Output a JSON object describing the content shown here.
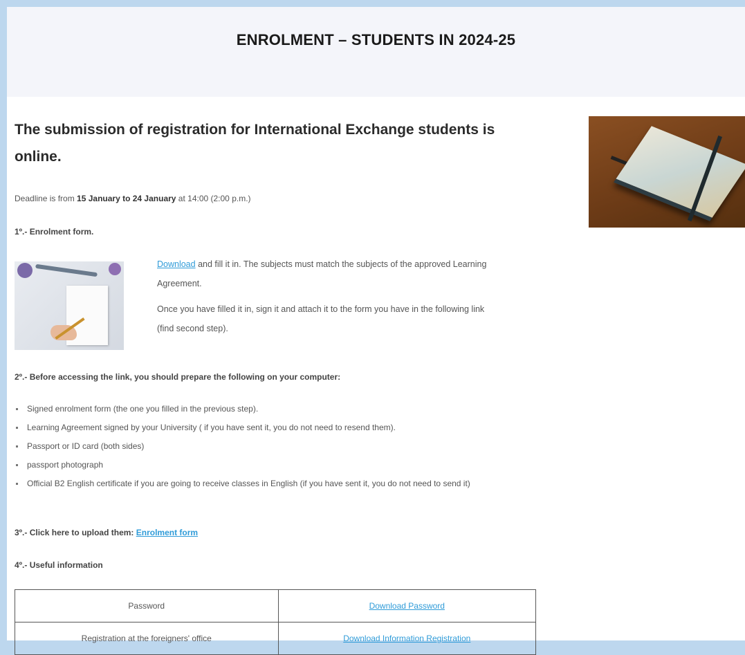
{
  "banner": {
    "title": "ENROLMENT – STUDENTS IN 2024-25"
  },
  "headline": "The submission of registration for International Exchange students is online.",
  "deadline": {
    "prefix": "Deadline is from ",
    "dates": "15 January to 24 January",
    "suffix": " at 14:00 (2:00 p.m.)"
  },
  "step1": {
    "title": "1º.- Enrolment form.",
    "download_link": "Download",
    "text_after_link": " and fill it in. The subjects must match the subjects of the approved Learning Agreement.",
    "paragraph2": "Once you have filled it in, sign it and attach it to the form you have in the following link (find second step)."
  },
  "step2": {
    "title": "2º.- Before accessing the link, you should prepare the following on your computer:",
    "items": [
      "Signed enrolment form (the one you filled in the previous step).",
      "Learning Agreement signed by your University ( if you have sent it, you do not need to resend them).",
      "Passport or ID card (both sides)",
      "passport photograph",
      "Official B2 English certificate if you are going to receive classes in English (if you have sent it, you do not need to send it)"
    ]
  },
  "step3": {
    "prefix": "3º.- Click here to upload them: ",
    "link": "Enrolment form"
  },
  "step4": {
    "title": "4º.- Useful information",
    "rows": [
      {
        "label": "Password",
        "link": "Download  Password"
      },
      {
        "label": "Registration at the foreigners' office",
        "link": "Download  Information  Registration"
      }
    ]
  }
}
